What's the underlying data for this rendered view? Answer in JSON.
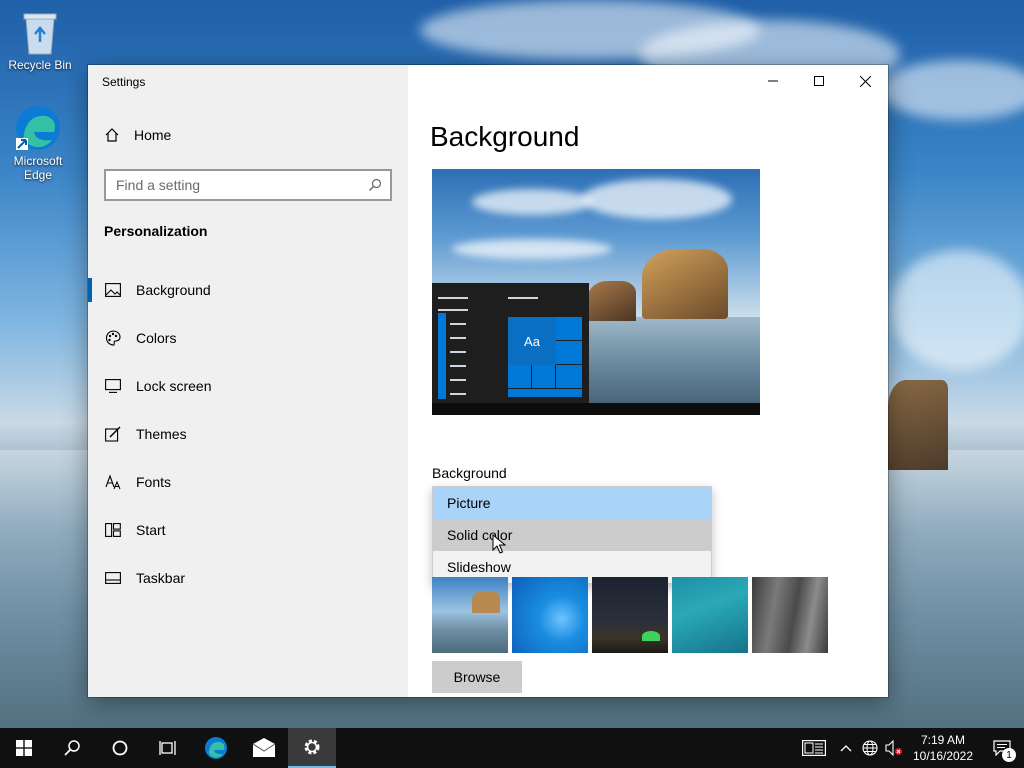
{
  "desktop": {
    "icons": [
      {
        "label": "Recycle Bin"
      },
      {
        "label": "Microsoft Edge"
      }
    ]
  },
  "window": {
    "title": "Settings",
    "controls": {
      "minimize": "minimize-icon",
      "maximize": "maximize-icon",
      "close": "close-icon"
    }
  },
  "sidebar": {
    "home_label": "Home",
    "search_placeholder": "Find a setting",
    "section": "Personalization",
    "items": [
      {
        "label": "Background",
        "icon": "picture-icon",
        "active": true
      },
      {
        "label": "Colors",
        "icon": "palette-icon"
      },
      {
        "label": "Lock screen",
        "icon": "lock-screen-icon"
      },
      {
        "label": "Themes",
        "icon": "themes-icon"
      },
      {
        "label": "Fonts",
        "icon": "fonts-icon"
      },
      {
        "label": "Start",
        "icon": "start-icon"
      },
      {
        "label": "Taskbar",
        "icon": "taskbar-icon"
      }
    ]
  },
  "main": {
    "title": "Background",
    "preview_tile_label": "Aa",
    "background_label": "Background",
    "dropdown": {
      "options": [
        "Picture",
        "Solid color",
        "Slideshow"
      ],
      "selected": "Picture",
      "hovered": "Solid color"
    },
    "browse_label": "Browse"
  },
  "taskbar": {
    "time": "7:19 AM",
    "date": "10/16/2022",
    "notification_count": "1"
  },
  "colors": {
    "accent": "#0078d7",
    "selected_option": "#a9d3f9",
    "hover_option": "#cccccc"
  }
}
